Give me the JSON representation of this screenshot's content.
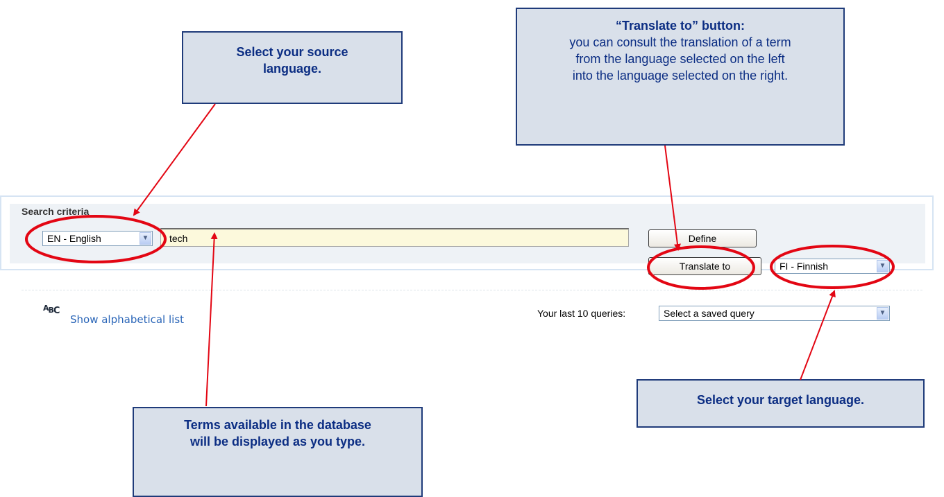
{
  "callouts": {
    "source_lang": {
      "line1": "Select your source",
      "line2": "language."
    },
    "translate_btn": {
      "heading": "“Translate to” button:",
      "line1": "you can consult the translation of a term",
      "line2": "from the language selected on the left",
      "line3": "into the language selected on the right."
    },
    "target_lang": {
      "line1": "Select your target language."
    },
    "terms": {
      "line1": "Terms available in the database",
      "line2": "will be displayed as you type."
    }
  },
  "search": {
    "title": "Search criteria",
    "source_language": "EN - English",
    "term_value": "tech",
    "define_label": "Define",
    "translate_label": "Translate to",
    "target_language": "FI - Finnish",
    "alpha_icon": "ABC",
    "alpha_link": "Show alphabetical list",
    "last_queries_label": "Your last 10 queries:",
    "saved_query": "Select a saved query"
  },
  "colors": {
    "annotation_red": "#e30613",
    "callout_fill": "#d9e0ea",
    "callout_border": "#1f3b7a",
    "callout_text": "#0b2d83",
    "link_blue": "#2b66b8",
    "input_fill": "#fcf9dc"
  },
  "icons": {
    "dropdown": "chevron-down-icon",
    "alphabet": "abc-icon"
  }
}
